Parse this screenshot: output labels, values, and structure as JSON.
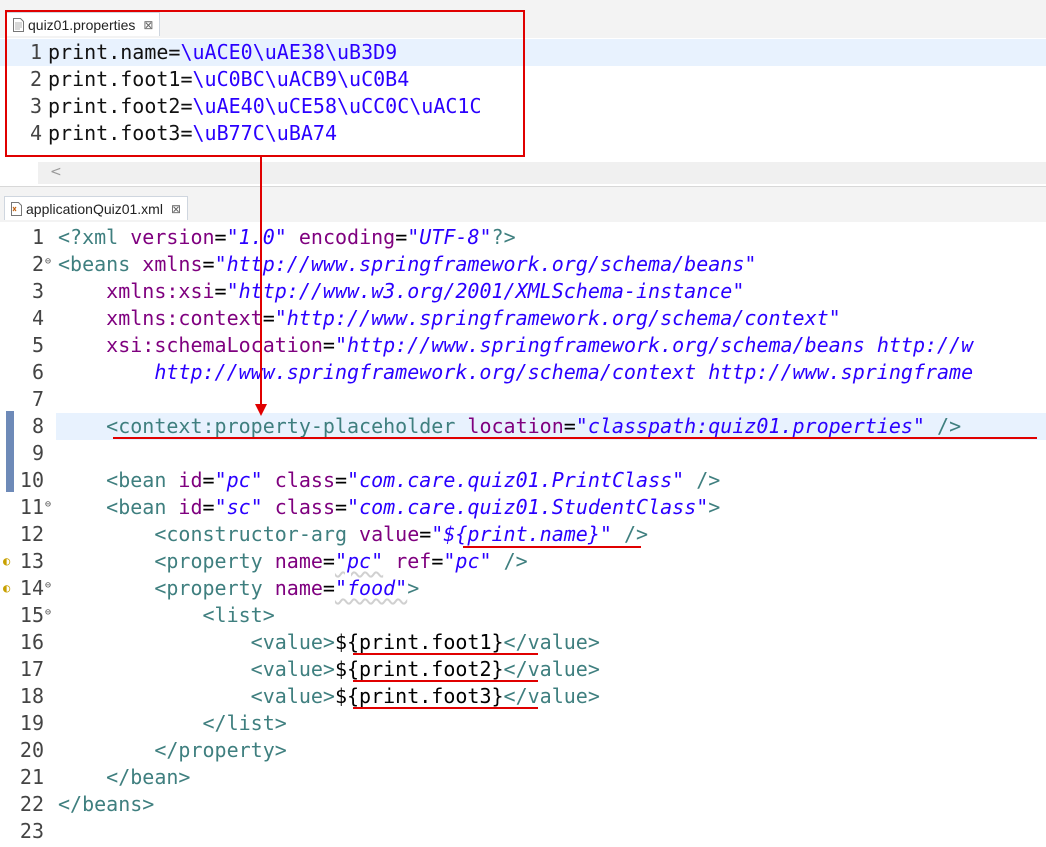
{
  "properties_tab": {
    "title": "quiz01.properties",
    "close": "⊠",
    "lines": [
      {
        "no": "1",
        "key": "print.name=",
        "value": "\\uACE0\\uAE38\\uB3D9"
      },
      {
        "no": "2",
        "key": "print.foot1=",
        "value": "\\uC0BC\\uACB9\\uC0B4"
      },
      {
        "no": "3",
        "key": "print.foot2=",
        "value": "\\uAE40\\uCE58\\uCC0C\\uAC1C"
      },
      {
        "no": "4",
        "key": "print.foot3=",
        "value": "\\uB77C\\uBA74"
      }
    ],
    "scroll_left": "<"
  },
  "xml_tab": {
    "title": "applicationQuiz01.xml",
    "close": "⊠"
  },
  "xml_lines": [
    {
      "no": "1",
      "tokens": [
        [
          "tag",
          "<?xml "
        ],
        [
          "attr",
          "version"
        ],
        [
          "txt",
          "="
        ],
        [
          "val",
          "\"1.0\""
        ],
        [
          "txt",
          " "
        ],
        [
          "attr",
          "encoding"
        ],
        [
          "txt",
          "="
        ],
        [
          "val",
          "\"UTF-8\""
        ],
        [
          "tag",
          "?>"
        ]
      ]
    },
    {
      "no": "2",
      "fold": "⊖",
      "tokens": [
        [
          "tag",
          "<beans "
        ],
        [
          "attr",
          "xmlns"
        ],
        [
          "txt",
          "="
        ],
        [
          "val",
          "\"http://www.springframework.org/schema/beans\""
        ]
      ]
    },
    {
      "no": "3",
      "tokens": [
        [
          "txt",
          "    "
        ],
        [
          "attr",
          "xmlns:xsi"
        ],
        [
          "txt",
          "="
        ],
        [
          "val",
          "\"http://www.w3.org/2001/XMLSchema-instance\""
        ]
      ]
    },
    {
      "no": "4",
      "tokens": [
        [
          "txt",
          "    "
        ],
        [
          "attr",
          "xmlns:context"
        ],
        [
          "txt",
          "="
        ],
        [
          "val",
          "\"http://www.springframework.org/schema/context\""
        ]
      ]
    },
    {
      "no": "5",
      "tokens": [
        [
          "txt",
          "    "
        ],
        [
          "attr",
          "xsi:schemaLocation"
        ],
        [
          "txt",
          "="
        ],
        [
          "val",
          "\"http://www.springframework.org/schema/beans http://w"
        ]
      ]
    },
    {
      "no": "6",
      "tokens": [
        [
          "val",
          "        http://www.springframework.org/schema/context http://www.springframe"
        ]
      ]
    },
    {
      "no": "7",
      "tokens": []
    },
    {
      "no": "8",
      "highlight": true,
      "tokens": [
        [
          "txt",
          "    "
        ],
        [
          "tag",
          "<context:property-placeholder "
        ],
        [
          "attr",
          "location"
        ],
        [
          "txt",
          "="
        ],
        [
          "val",
          "\"classpath:quiz01.properties\""
        ],
        [
          "tag",
          " />"
        ]
      ]
    },
    {
      "no": "9",
      "tokens": []
    },
    {
      "no": "10",
      "tokens": [
        [
          "txt",
          "    "
        ],
        [
          "tag",
          "<bean "
        ],
        [
          "attr",
          "id"
        ],
        [
          "txt",
          "="
        ],
        [
          "val",
          "\"pc\""
        ],
        [
          "txt",
          " "
        ],
        [
          "attr",
          "class"
        ],
        [
          "txt",
          "="
        ],
        [
          "val",
          "\"com.care.quiz01.PrintClass\""
        ],
        [
          "tag",
          " />"
        ]
      ]
    },
    {
      "no": "11",
      "fold": "⊖",
      "tokens": [
        [
          "txt",
          "    "
        ],
        [
          "tag",
          "<bean "
        ],
        [
          "attr",
          "id"
        ],
        [
          "txt",
          "="
        ],
        [
          "val",
          "\"sc\""
        ],
        [
          "txt",
          " "
        ],
        [
          "attr",
          "class"
        ],
        [
          "txt",
          "="
        ],
        [
          "val",
          "\"com.care.quiz01.StudentClass\""
        ],
        [
          "tag",
          ">"
        ]
      ]
    },
    {
      "no": "12",
      "tokens": [
        [
          "txt",
          "        "
        ],
        [
          "tag",
          "<constructor-arg "
        ],
        [
          "attr",
          "value"
        ],
        [
          "txt",
          "="
        ],
        [
          "val",
          "\"${print.name}\""
        ],
        [
          "tag",
          " />"
        ]
      ]
    },
    {
      "no": "13",
      "marker": true,
      "tokens": [
        [
          "txt",
          "        "
        ],
        [
          "tag",
          "<property "
        ],
        [
          "attr",
          "name"
        ],
        [
          "txt",
          "="
        ],
        [
          "val",
          "\"pc\""
        ],
        [
          "txt",
          " "
        ],
        [
          "attr",
          "ref"
        ],
        [
          "txt",
          "="
        ],
        [
          "val",
          "\"pc\""
        ],
        [
          "tag",
          " />"
        ]
      ]
    },
    {
      "no": "14",
      "marker": true,
      "fold": "⊖",
      "tokens": [
        [
          "txt",
          "        "
        ],
        [
          "tag",
          "<property "
        ],
        [
          "attr",
          "name"
        ],
        [
          "txt",
          "="
        ],
        [
          "val",
          "\"food\""
        ],
        [
          "tag",
          ">"
        ]
      ]
    },
    {
      "no": "15",
      "fold": "⊖",
      "tokens": [
        [
          "txt",
          "            "
        ],
        [
          "tag",
          "<list>"
        ]
      ]
    },
    {
      "no": "16",
      "tokens": [
        [
          "txt",
          "                "
        ],
        [
          "tag",
          "<value>"
        ],
        [
          "txt",
          "${print.foot1}"
        ],
        [
          "tag",
          "</value>"
        ]
      ]
    },
    {
      "no": "17",
      "tokens": [
        [
          "txt",
          "                "
        ],
        [
          "tag",
          "<value>"
        ],
        [
          "txt",
          "${print.foot2}"
        ],
        [
          "tag",
          "</value>"
        ]
      ]
    },
    {
      "no": "18",
      "tokens": [
        [
          "txt",
          "                "
        ],
        [
          "tag",
          "<value>"
        ],
        [
          "txt",
          "${print.foot3}"
        ],
        [
          "tag",
          "</value>"
        ]
      ]
    },
    {
      "no": "19",
      "tokens": [
        [
          "txt",
          "            "
        ],
        [
          "tag",
          "</list>"
        ]
      ]
    },
    {
      "no": "20",
      "tokens": [
        [
          "txt",
          "        "
        ],
        [
          "tag",
          "</property>"
        ]
      ]
    },
    {
      "no": "21",
      "tokens": [
        [
          "txt",
          "    "
        ],
        [
          "tag",
          "</bean>"
        ]
      ]
    },
    {
      "no": "22",
      "tokens": [
        [
          "tag",
          "</beans>"
        ]
      ]
    },
    {
      "no": "23",
      "tokens": []
    }
  ],
  "colors": {
    "annotation": "#e00000",
    "tag": "#3f7f7f",
    "attribute": "#7f007f",
    "string": "#2a00ff",
    "current_line": "#e8f2fe"
  }
}
